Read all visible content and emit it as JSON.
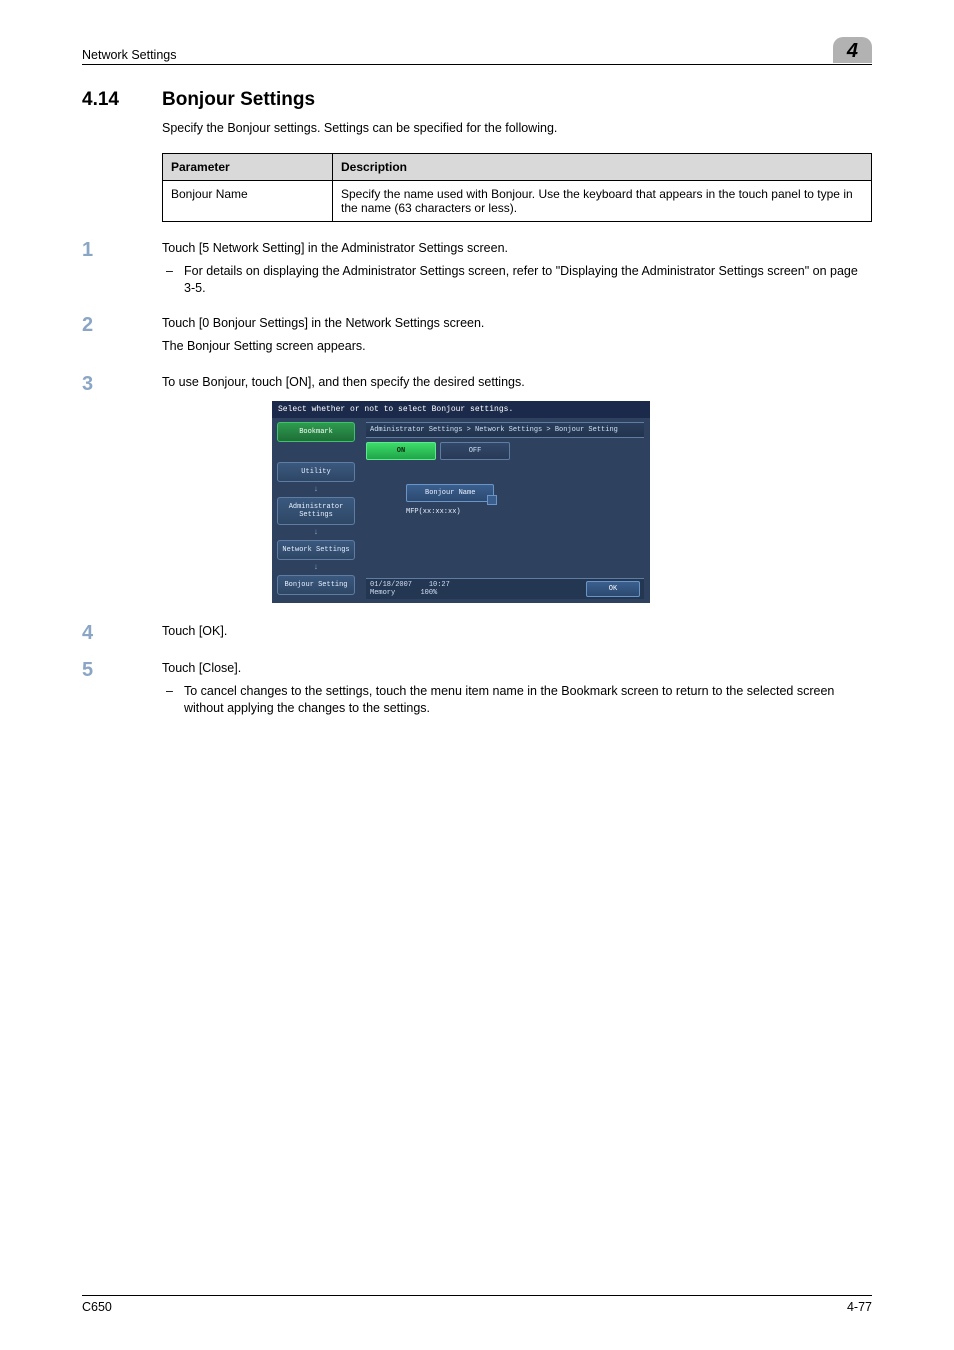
{
  "header": {
    "section_label": "Network Settings",
    "chapter_number": "4"
  },
  "section": {
    "number": "4.14",
    "title": "Bonjour Settings",
    "intro": "Specify the Bonjour settings. Settings can be specified for the following."
  },
  "param_table": {
    "headers": {
      "param": "Parameter",
      "desc": "Description"
    },
    "rows": [
      {
        "param": "Bonjour Name",
        "desc": "Specify the name used with Bonjour. Use the keyboard that appears in the touch panel to type in the name (63 characters or less)."
      }
    ]
  },
  "steps": [
    {
      "num": "1",
      "lines": [
        "Touch [5 Network Setting] in the Administrator Settings screen."
      ],
      "sub": [
        "For details on displaying the Administrator Settings screen, refer to \"Displaying the Administrator Settings screen\" on page 3-5."
      ]
    },
    {
      "num": "2",
      "lines": [
        "Touch [0 Bonjour Settings] in the Network Settings screen.",
        "The Bonjour Setting screen appears."
      ]
    },
    {
      "num": "3",
      "lines": [
        "To use Bonjour, touch [ON], and then specify the desired settings."
      ]
    },
    {
      "num": "4",
      "lines": [
        "Touch [OK]."
      ]
    },
    {
      "num": "5",
      "lines": [
        "Touch [Close]."
      ],
      "sub": [
        "To cancel changes to the settings, touch the menu item name in the Bookmark screen to return to the selected screen without applying the changes to the settings."
      ]
    }
  ],
  "touchpanel": {
    "instruction": "Select whether or not to select Bonjour settings.",
    "bookmark_label": "Bookmark",
    "nav_items": [
      "Utility",
      "Administrator Settings",
      "Network Settings",
      "Bonjour Setting"
    ],
    "breadcrumb": "Administrator Settings > Network Settings > Bonjour Setting",
    "tab_on": "ON",
    "tab_off": "OFF",
    "field_label": "Bonjour Name",
    "field_value": "MFP(xx:xx:xx)",
    "status": {
      "date": "01/18/2007",
      "time": "10:27",
      "mem_label": "Memory",
      "mem_value": "100%"
    },
    "ok_label": "OK"
  },
  "footer": {
    "model": "C650",
    "page": "4-77"
  }
}
